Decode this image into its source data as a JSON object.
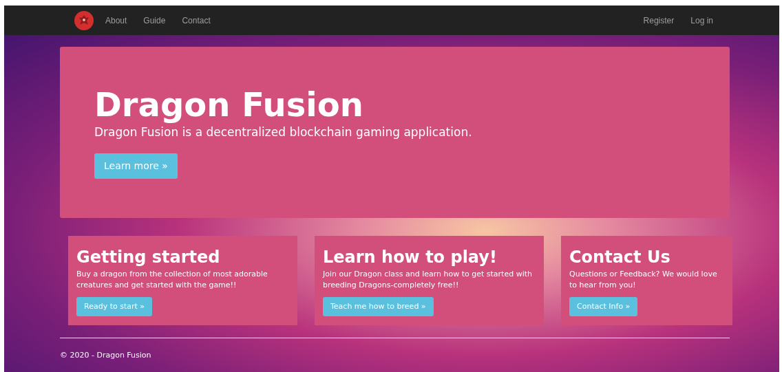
{
  "navbar": {
    "left_links": [
      "About",
      "Guide",
      "Contact"
    ],
    "right_links": [
      "Register",
      "Log in"
    ]
  },
  "hero": {
    "title": "Dragon Fusion",
    "subtitle": "Dragon Fusion is a decentralized blockchain gaming application.",
    "button": "Learn more »"
  },
  "cards": [
    {
      "title": "Getting started",
      "text": "Buy a dragon from the collection of most adorable creatures and get started with the game!!",
      "button": "Ready to start »"
    },
    {
      "title": "Learn how to play!",
      "text": "Join our Dragon class and learn how to get started with breeding Dragons-completely free!!",
      "button": "Teach me how to breed »"
    },
    {
      "title": "Contact Us",
      "text": "Questions or Feedback? We would love to hear from you!",
      "button": "Contact Info »"
    }
  ],
  "footer": "© 2020 - Dragon Fusion"
}
